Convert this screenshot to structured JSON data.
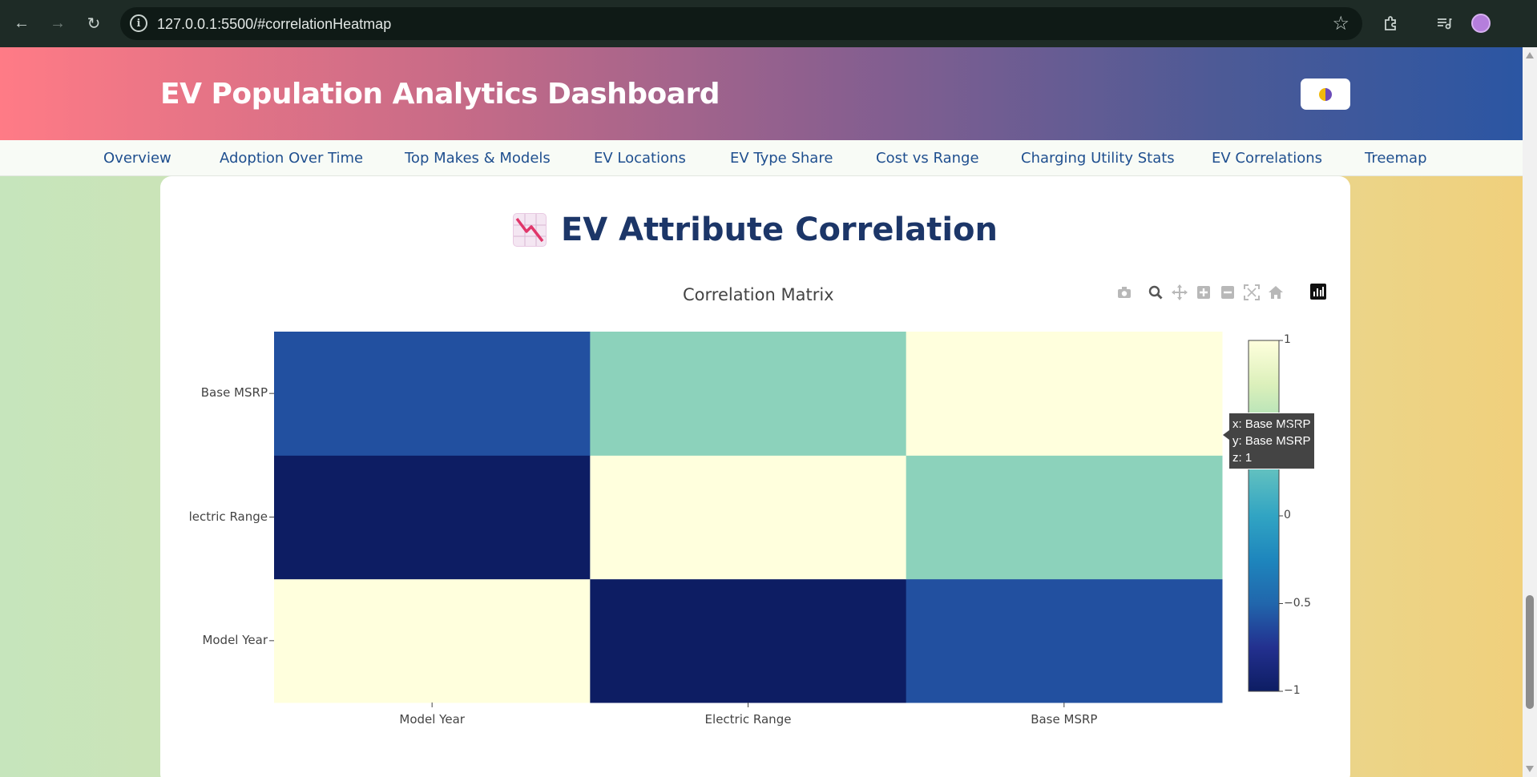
{
  "browser": {
    "url": "127.0.0.1:5500/#correlationHeatmap",
    "back_icon": "back-arrow-icon",
    "forward_icon": "forward-arrow-icon",
    "reload_icon": "reload-icon",
    "site_info_icon": "info-icon",
    "bookmark_icon": "star-icon",
    "extensions_icon": "puzzle-icon",
    "media_icon": "media-queue-icon",
    "profile_icon": "avatar"
  },
  "header": {
    "title": "EV Population Analytics Dashboard",
    "theme_toggle_icon": "theme-toggle-icon"
  },
  "nav": {
    "items": [
      {
        "label": "Overview"
      },
      {
        "label": "Adoption Over Time"
      },
      {
        "label": "Top Makes & Models"
      },
      {
        "label": "EV Locations"
      },
      {
        "label": "EV Type Share"
      },
      {
        "label": "Cost vs Range"
      },
      {
        "label": "Charging Utility Stats"
      },
      {
        "label": "EV Correlations"
      },
      {
        "label": "Treemap"
      }
    ]
  },
  "section": {
    "title": "EV Attribute Correlation",
    "title_icon": "chart-decreasing-icon"
  },
  "modebar": {
    "icons": [
      "camera-icon",
      "zoom-icon",
      "pan-icon",
      "zoom-in-icon",
      "zoom-out-icon",
      "autoscale-icon",
      "home-icon",
      "plotly-logo-icon"
    ]
  },
  "chart_data": {
    "type": "heatmap",
    "title": "Correlation Matrix",
    "x": [
      "Model Year",
      "Electric Range",
      "Base MSRP"
    ],
    "y": [
      "Model Year",
      "Electric Range",
      "Base MSRP"
    ],
    "y_tick_labels_shown": [
      "Model Year",
      "lectric Range",
      "Base MSRP"
    ],
    "z": [
      [
        1,
        -1,
        -0.6
      ],
      [
        -1,
        1,
        0.4
      ],
      [
        -0.6,
        0.4,
        1
      ]
    ],
    "zmin": -1,
    "zmax": 1,
    "colorscale": "YlGnBu",
    "colorbar_ticks": [
      "1",
      "0.5",
      "0",
      "−0.5",
      "−1"
    ],
    "colorbar_tick_values": [
      1,
      0.5,
      0,
      -0.5,
      -1
    ],
    "hover": {
      "x": "x: Base MSRP",
      "y": "y: Base MSRP",
      "z": "z: 1"
    }
  }
}
